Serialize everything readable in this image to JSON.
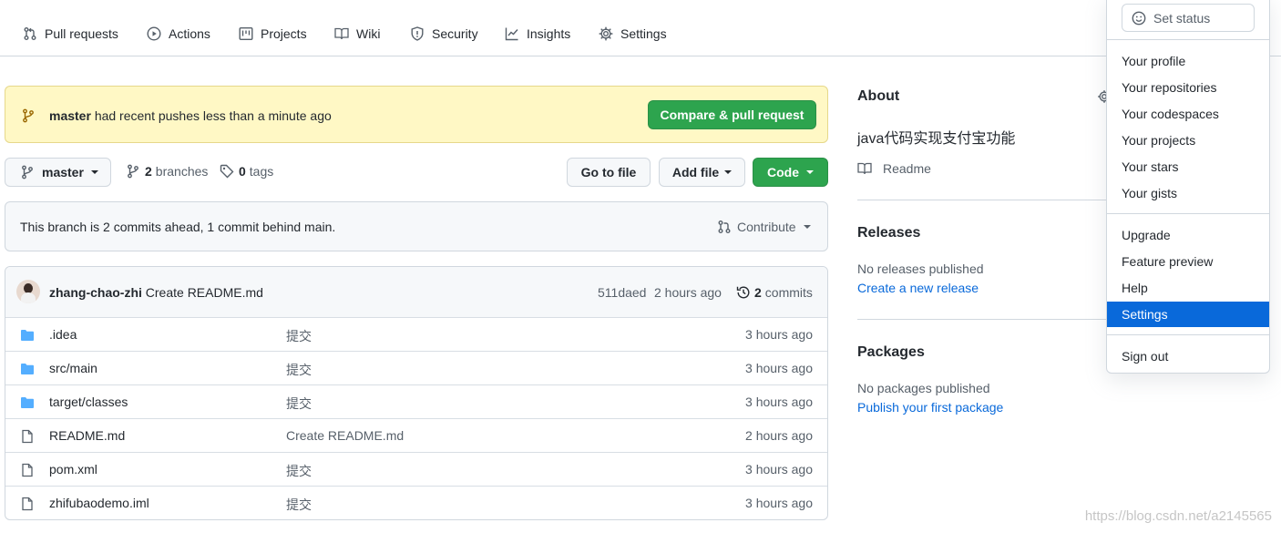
{
  "nav": {
    "items": [
      {
        "label": "Pull requests",
        "icon": "pull-request-icon"
      },
      {
        "label": "Actions",
        "icon": "play-icon"
      },
      {
        "label": "Projects",
        "icon": "project-icon"
      },
      {
        "label": "Wiki",
        "icon": "book-icon"
      },
      {
        "label": "Security",
        "icon": "shield-icon"
      },
      {
        "label": "Insights",
        "icon": "graph-icon"
      },
      {
        "label": "Settings",
        "icon": "gear-icon"
      }
    ]
  },
  "banner": {
    "branch": "master",
    "message": "had recent pushes less than a minute ago",
    "button": "Compare & pull request"
  },
  "toolbar": {
    "branch": "master",
    "branches_count": "2",
    "branches_label": "branches",
    "tags_count": "0",
    "tags_label": "tags",
    "go_to_file": "Go to file",
    "add_file": "Add file",
    "code": "Code"
  },
  "compare": {
    "text": "This branch is 2 commits ahead, 1 commit behind main.",
    "contribute": "Contribute"
  },
  "commit": {
    "author": "zhang-chao-zhi",
    "message": "Create README.md",
    "sha": "511daed",
    "time": "2 hours ago",
    "commits_count": "2",
    "commits_label": "commits"
  },
  "files": [
    {
      "name": ".idea",
      "type": "folder",
      "message": "提交",
      "age": "3 hours ago"
    },
    {
      "name": "src/main",
      "type": "folder",
      "message": "提交",
      "age": "3 hours ago"
    },
    {
      "name": "target/classes",
      "type": "folder",
      "message": "提交",
      "age": "3 hours ago"
    },
    {
      "name": "README.md",
      "type": "file",
      "message": "Create README.md",
      "age": "2 hours ago"
    },
    {
      "name": "pom.xml",
      "type": "file",
      "message": "提交",
      "age": "3 hours ago"
    },
    {
      "name": "zhifubaodemo.iml",
      "type": "file",
      "message": "提交",
      "age": "3 hours ago"
    }
  ],
  "about": {
    "title": "About",
    "description": "java代码实现支付宝功能",
    "readme": "Readme"
  },
  "releases": {
    "title": "Releases",
    "empty": "No releases published",
    "link": "Create a new release"
  },
  "packages": {
    "title": "Packages",
    "empty": "No packages published",
    "link": "Publish your first package"
  },
  "dropdown": {
    "set_status": "Set status",
    "group1": [
      "Your profile",
      "Your repositories",
      "Your codespaces",
      "Your projects",
      "Your stars",
      "Your gists"
    ],
    "group2": [
      "Upgrade",
      "Feature preview",
      "Help",
      "Settings"
    ],
    "sign_out": "Sign out",
    "active": "Settings"
  },
  "watermark": "https://blog.csdn.net/a2145565",
  "colors": {
    "green": "#2da44e",
    "link": "#0969da",
    "banner_bg": "#fff8c5",
    "folder": "#54aeff",
    "active_item": "#0969da"
  }
}
